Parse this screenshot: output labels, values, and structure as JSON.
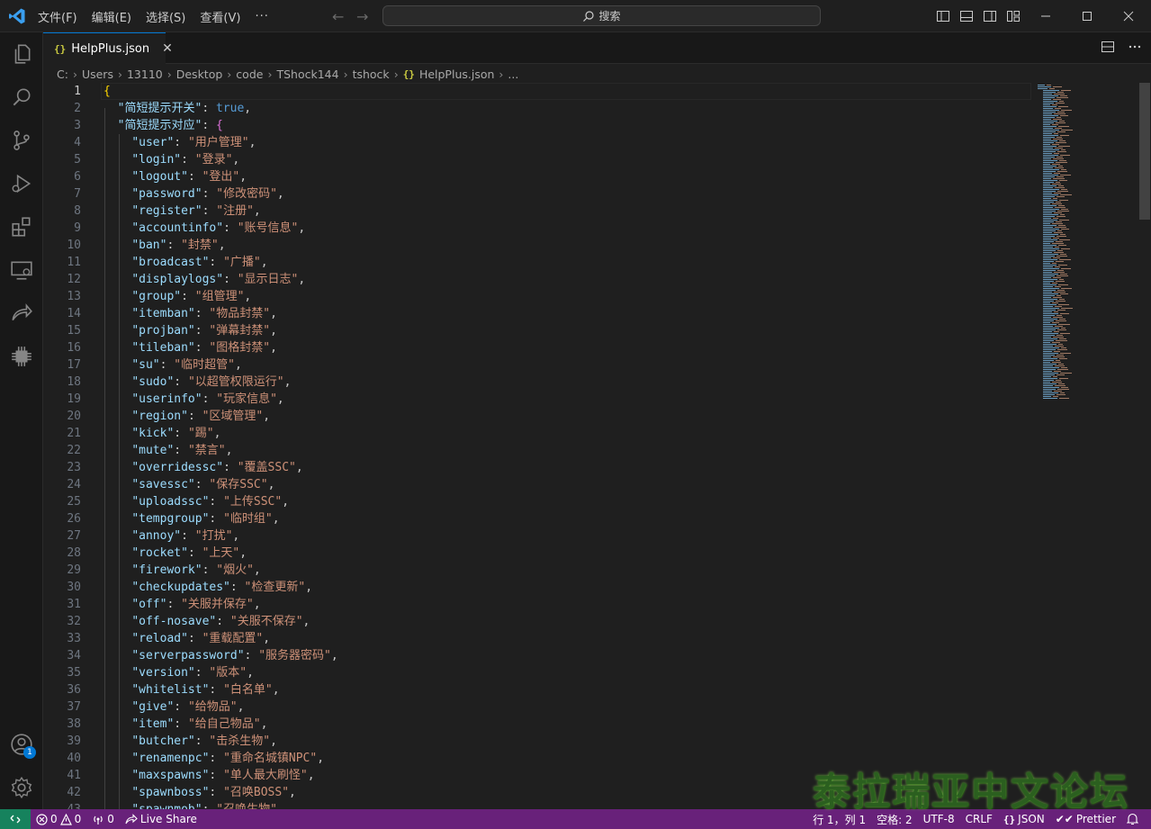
{
  "titlebar": {
    "menus": [
      "文件(F)",
      "编辑(E)",
      "选择(S)",
      "查看(V)"
    ],
    "more": "···",
    "search_placeholder": "搜索"
  },
  "activity_bar": {
    "items": [
      "explorer-icon",
      "search-icon",
      "source-control-icon",
      "run-debug-icon",
      "extensions-icon",
      "remote-explorer-icon",
      "live-share-icon",
      "chip-icon"
    ],
    "bottom": [
      "accounts-icon",
      "settings-gear-icon"
    ],
    "account_badge": "1"
  },
  "tab": {
    "icon": "{}",
    "label": "HelpPlus.json",
    "close": "✕"
  },
  "breadcrumb": [
    "C:",
    "Users",
    "13110",
    "Desktop",
    "code",
    "TShock144",
    "tshock",
    "HelpPlus.json",
    "..."
  ],
  "editor": {
    "top_key": "简短提示开关",
    "top_value": "true",
    "map_key": "简短提示对应",
    "entries": [
      [
        "user",
        "用户管理"
      ],
      [
        "login",
        "登录"
      ],
      [
        "logout",
        "登出"
      ],
      [
        "password",
        "修改密码"
      ],
      [
        "register",
        "注册"
      ],
      [
        "accountinfo",
        "账号信息"
      ],
      [
        "ban",
        "封禁"
      ],
      [
        "broadcast",
        "广播"
      ],
      [
        "displaylogs",
        "显示日志"
      ],
      [
        "group",
        "组管理"
      ],
      [
        "itemban",
        "物品封禁"
      ],
      [
        "projban",
        "弹幕封禁"
      ],
      [
        "tileban",
        "图格封禁"
      ],
      [
        "su",
        "临时超管"
      ],
      [
        "sudo",
        "以超管权限运行"
      ],
      [
        "userinfo",
        "玩家信息"
      ],
      [
        "region",
        "区域管理"
      ],
      [
        "kick",
        "踢"
      ],
      [
        "mute",
        "禁言"
      ],
      [
        "overridessc",
        "覆盖SSC"
      ],
      [
        "savessc",
        "保存SSC"
      ],
      [
        "uploadssc",
        "上传SSC"
      ],
      [
        "tempgroup",
        "临时组"
      ],
      [
        "annoy",
        "打扰"
      ],
      [
        "rocket",
        "上天"
      ],
      [
        "firework",
        "烟火"
      ],
      [
        "checkupdates",
        "检查更新"
      ],
      [
        "off",
        "关服并保存"
      ],
      [
        "off-nosave",
        "关服不保存"
      ],
      [
        "reload",
        "重载配置"
      ],
      [
        "serverpassword",
        "服务器密码"
      ],
      [
        "version",
        "版本"
      ],
      [
        "whitelist",
        "白名单"
      ],
      [
        "give",
        "给物品"
      ],
      [
        "item",
        "给自己物品"
      ],
      [
        "butcher",
        "击杀生物"
      ],
      [
        "renamenpc",
        "重命名城镇NPC"
      ],
      [
        "maxspawns",
        "单人最大刷怪"
      ],
      [
        "spawnboss",
        "召唤BOSS"
      ],
      [
        "spawnmob",
        "召唤生物"
      ]
    ]
  },
  "statusbar": {
    "errors": "0",
    "warnings": "0",
    "ports": "0",
    "live_share": "Live Share",
    "position": "行 1，列 1",
    "spaces": "空格: 2",
    "encoding": "UTF-8",
    "eol": "CRLF",
    "language": "JSON",
    "formatter": "Prettier"
  },
  "watermark": "泰拉瑞亚中文论坛",
  "colors": {
    "statusbar": "#68217a",
    "key": "#9cdcfe",
    "string": "#ce9178",
    "boolean": "#569cd6",
    "accent": "#0078d4"
  }
}
